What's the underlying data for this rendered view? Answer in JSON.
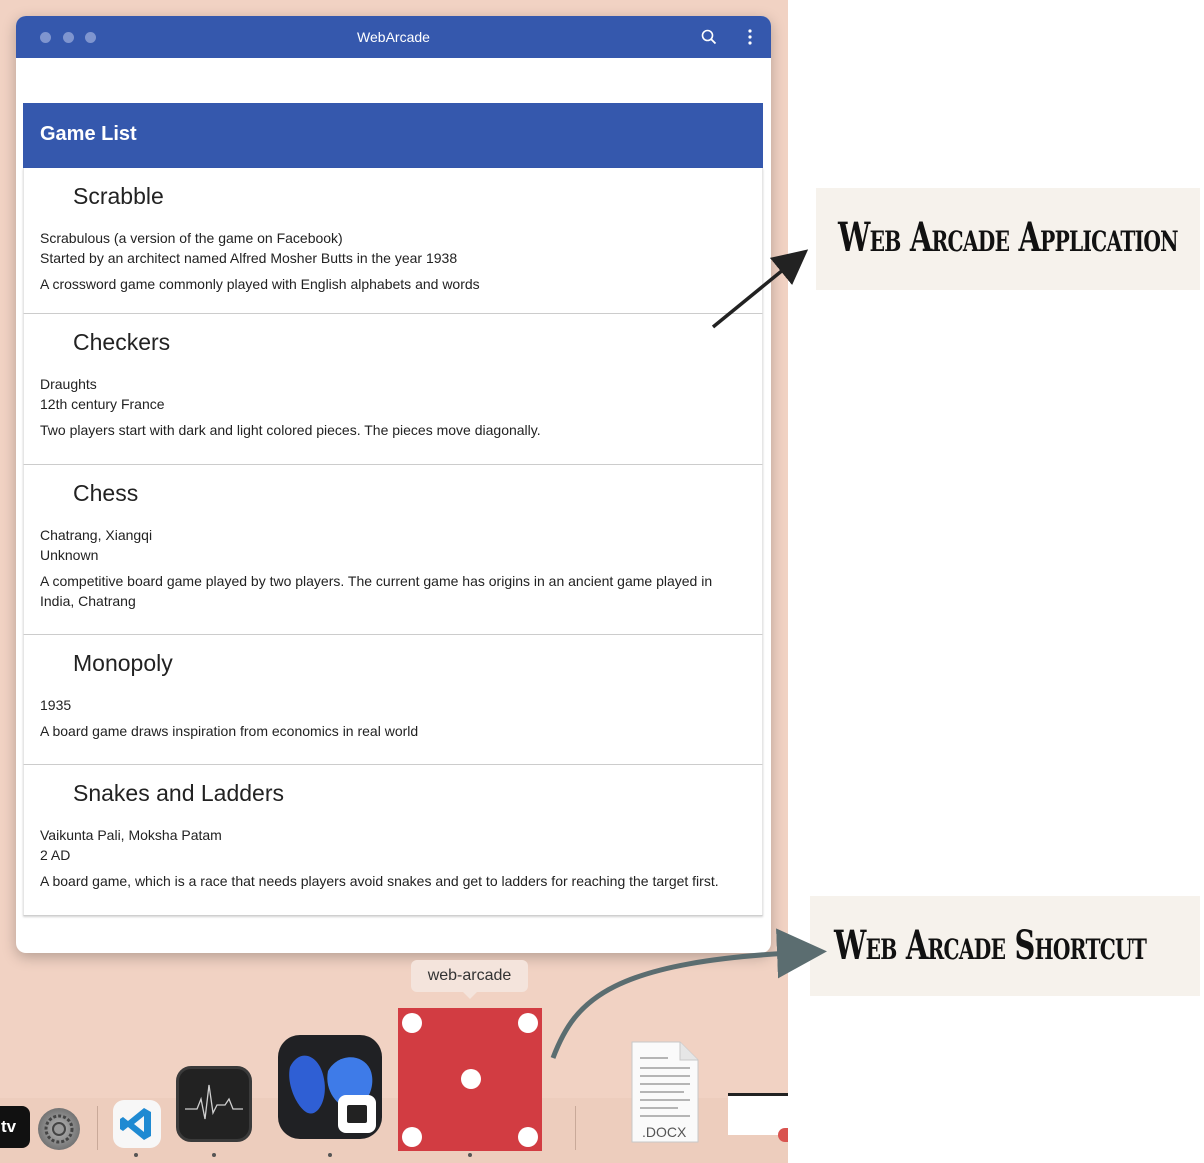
{
  "window": {
    "title": "WebArcade"
  },
  "header": {
    "title": "Game List"
  },
  "games": [
    {
      "name": "Scrabble",
      "alt_names": "Scrabulous (a version of the game on Facebook)",
      "origin": "Started by an architect named Alfred Mosher Butts in the year 1938",
      "description": "A crossword game commonly played with English alphabets and words"
    },
    {
      "name": "Checkers",
      "alt_names": "Draughts",
      "origin": "12th century France",
      "description": "Two players start with dark and light colored pieces. The pieces move diagonally."
    },
    {
      "name": "Chess",
      "alt_names": "Chatrang, Xiangqi",
      "origin": "Unknown",
      "description": "A competitive board game played by two players. The current game has origins in an ancient game played in India, Chatrang"
    },
    {
      "name": "Monopoly",
      "alt_names": "",
      "origin": "1935",
      "description": "A board game draws inspiration from economics in real world"
    },
    {
      "name": "Snakes and Ladders",
      "alt_names": "Vaikunta Pali, Moksha Patam",
      "origin": "2 AD",
      "description": "A board game, which is a race that needs players avoid snakes and get to ladders for reaching the target first."
    }
  ],
  "dock": {
    "tooltip": "web-arcade",
    "tv_label": "tv",
    "docx_label": ".DOCX"
  },
  "annotations": {
    "app_label": "Web Arcade Application",
    "shortcut_label": "Web Arcade Shortcut"
  },
  "colors": {
    "primary": "#3558ad",
    "dice": "#d23c42",
    "desktop": "#f1d2c3"
  }
}
